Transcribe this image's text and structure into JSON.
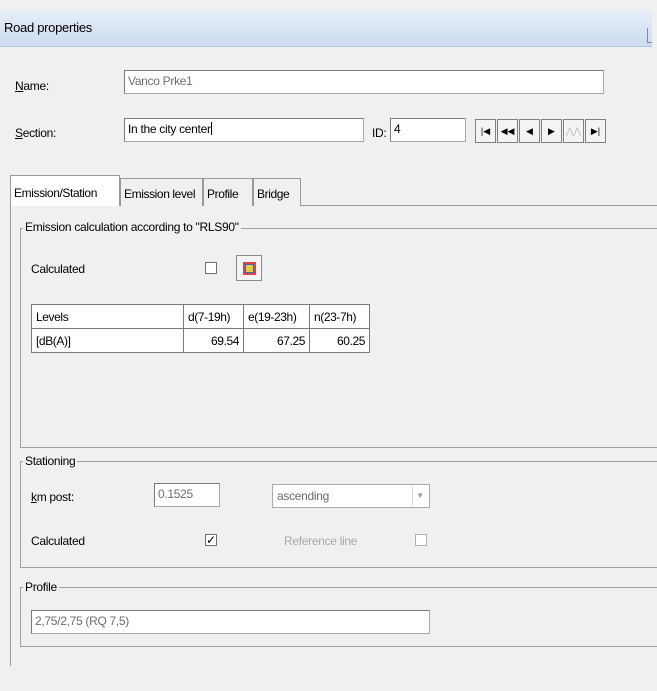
{
  "window": {
    "title": "Road properties"
  },
  "form": {
    "name_label_u": "N",
    "name_label_rest": "ame:",
    "name_value": "Vanco Prke1",
    "section_label_u": "S",
    "section_label_rest": "ection:",
    "section_value": "In the city center",
    "id_label": "ID:",
    "id_value": "4"
  },
  "nav_buttons": [
    {
      "name": "first",
      "glyph": "|◀"
    },
    {
      "name": "prev-fast",
      "glyph": "◀◀"
    },
    {
      "name": "prev",
      "glyph": "◀"
    },
    {
      "name": "next",
      "glyph": "▶"
    },
    {
      "name": "polyline",
      "glyph": "⋀⋀"
    },
    {
      "name": "last",
      "glyph": "▶|"
    }
  ],
  "tabs": [
    "Emission/Station",
    "Emission level",
    "Profile",
    "Bridge"
  ],
  "emission": {
    "group_label": "Emission calculation according to \"RLS90\"",
    "calculated_label": "Calculated",
    "table": {
      "headers": [
        "Levels",
        "d(7-19h)",
        "e(19-23h)",
        "n(23-7h)"
      ],
      "rows": [
        [
          "[dB(A)]",
          "69.54",
          "67.25",
          "60.25"
        ]
      ]
    }
  },
  "stationing": {
    "group_label": "Stationing",
    "km_label_u": "k",
    "km_label_rest": "m post:",
    "km_value": "0.1525",
    "direction_value": "ascending",
    "calculated_label": "Calculated",
    "calculated_check": "✓",
    "reference_label": "Reference line"
  },
  "profile": {
    "group_label": "Profile",
    "value": "2,75/2,75 (RQ 7,5)"
  }
}
